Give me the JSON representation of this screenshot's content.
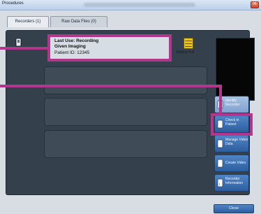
{
  "window": {
    "title": "Procedures"
  },
  "tabs": [
    {
      "label": "Recorders (1)"
    },
    {
      "label": "Raw Data Files (0)"
    }
  ],
  "recorder": {
    "last_use": "Last Use: Recording",
    "status": "Given Imaging",
    "patient": "Patient ID:   12345",
    "battery": "Battery Full"
  },
  "actions": [
    {
      "label": "Identify Recorder",
      "icon": "recorder-icon"
    },
    {
      "label": "Check in Patient",
      "icon": "recorder-icon"
    },
    {
      "label": "Manage Video Data",
      "icon": "recorder-icon"
    },
    {
      "label": "Create Video",
      "icon": "recorder-icon"
    },
    {
      "label": "Recorder Information",
      "icon": "recorder-info-icon"
    }
  ],
  "footer": {
    "close_label": "Close"
  },
  "colors": {
    "annotation": "#b3368d",
    "panel": "#34404b",
    "button": "#2d5e9f",
    "battery": "#f1c500"
  }
}
